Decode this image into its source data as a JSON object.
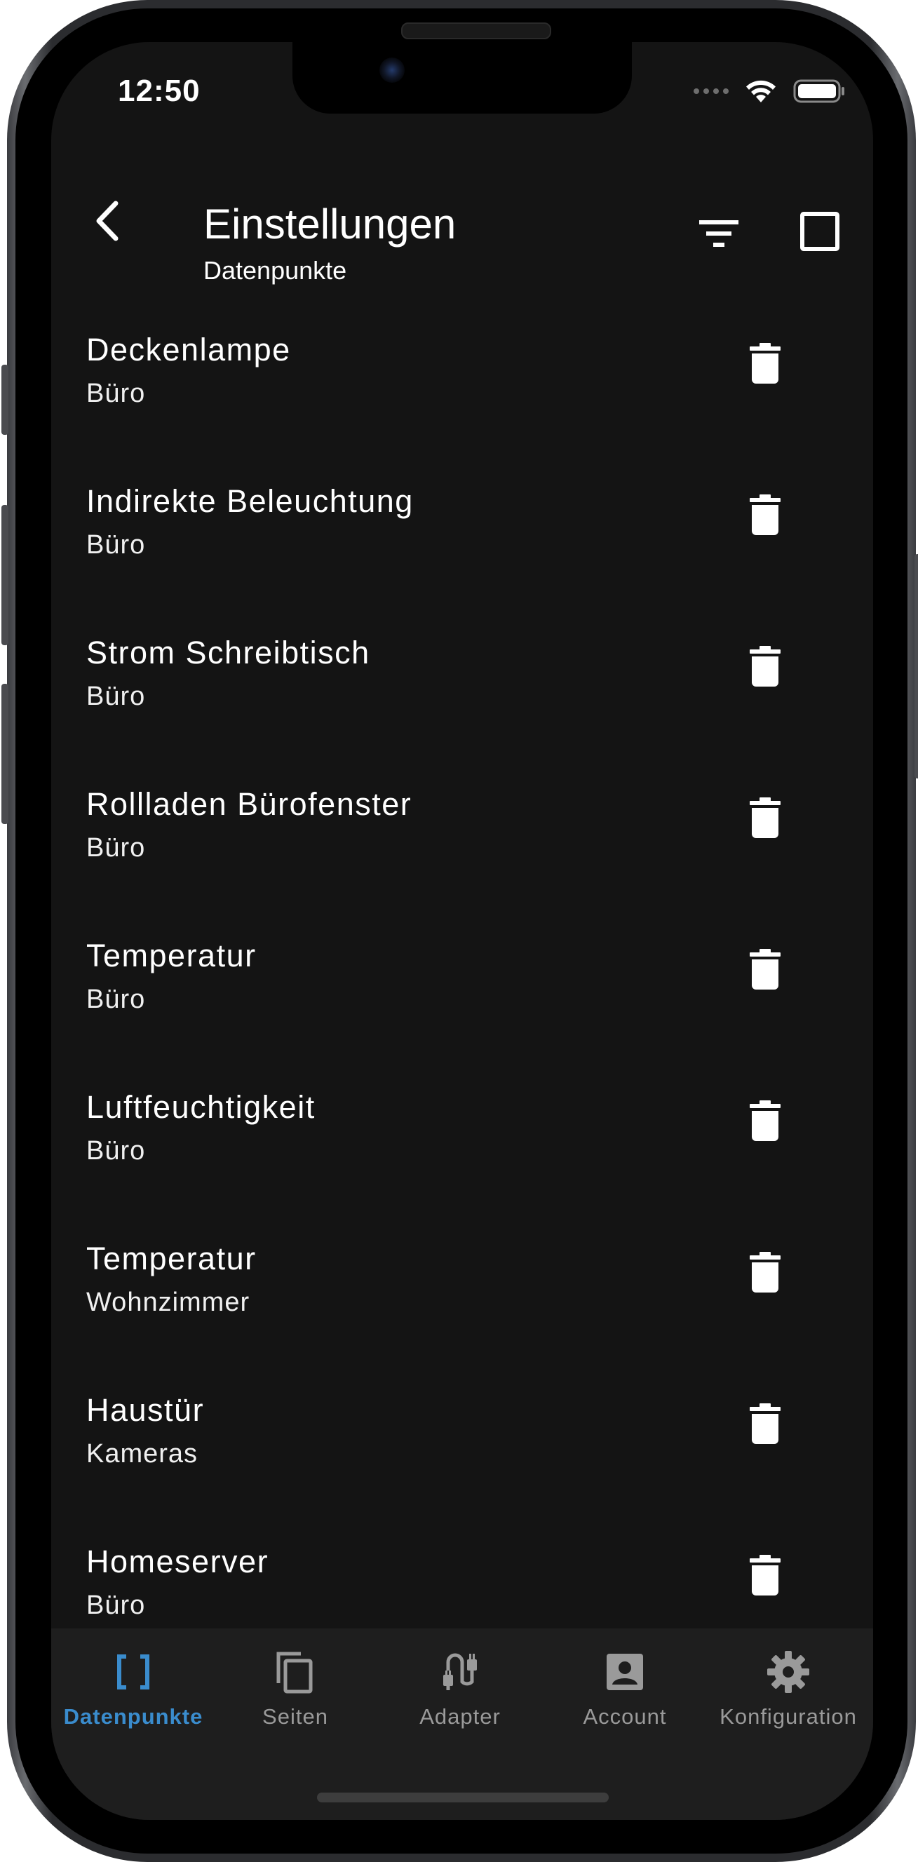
{
  "status_bar": {
    "time": "12:50"
  },
  "header": {
    "title": "Einstellungen",
    "subtitle": "Datenpunkte",
    "back_icon": "chevron-left-icon",
    "filter_icon": "filter-icon",
    "select_icon": "checkbox-outline-icon"
  },
  "datapoints": [
    {
      "name": "Deckenlampe",
      "room": "Büro"
    },
    {
      "name": "Indirekte Beleuchtung",
      "room": "Büro"
    },
    {
      "name": "Strom Schreibtisch",
      "room": "Büro"
    },
    {
      "name": "Rollladen Bürofenster",
      "room": "Büro"
    },
    {
      "name": "Temperatur",
      "room": "Büro"
    },
    {
      "name": "Luftfeuchtigkeit",
      "room": "Büro"
    },
    {
      "name": "Temperatur",
      "room": "Wohnzimmer"
    },
    {
      "name": "Haustür",
      "room": "Kameras"
    },
    {
      "name": "Homeserver",
      "room": "Büro"
    }
  ],
  "bottom_nav": {
    "items": [
      {
        "label": "Datenpunkte",
        "icon": "brackets-icon",
        "active": true
      },
      {
        "label": "Seiten",
        "icon": "copy-pages-icon",
        "active": false
      },
      {
        "label": "Adapter",
        "icon": "plug-cable-icon",
        "active": false
      },
      {
        "label": "Account",
        "icon": "account-box-icon",
        "active": false
      },
      {
        "label": "Konfiguration",
        "icon": "gear-icon",
        "active": false
      }
    ]
  },
  "colors": {
    "background": "#141414",
    "nav_background": "#1e1e1e",
    "accent": "#3a8ccd",
    "inactive": "#9a9a9a",
    "text": "#ffffff"
  }
}
